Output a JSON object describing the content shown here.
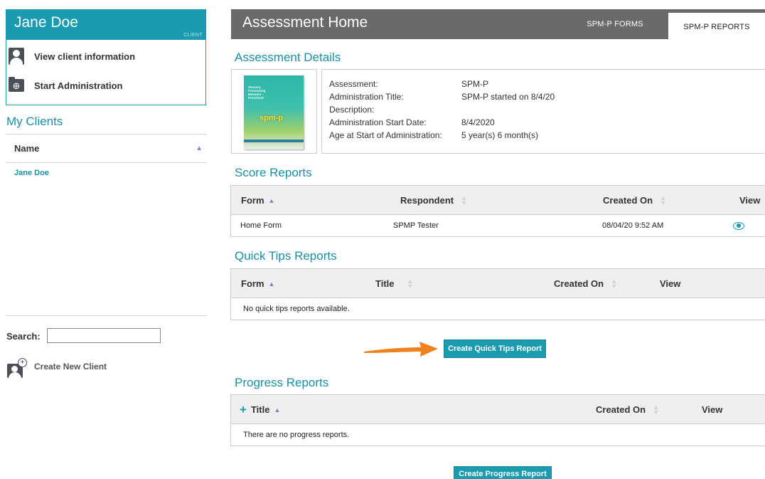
{
  "client": {
    "name": "Jane Doe",
    "tag": "CLIENT",
    "view_info_label": "View client information",
    "start_admin_label": "Start Administration"
  },
  "my_clients": {
    "title": "My Clients",
    "column": "Name",
    "items": [
      "Jane Doe"
    ]
  },
  "search": {
    "label": "Search:",
    "value": ""
  },
  "new_client_label": "Create New Client",
  "header": {
    "title": "Assessment Home",
    "tabs": [
      {
        "label": "SPM-P FORMS",
        "active": false
      },
      {
        "label": "SPM-P REPORTS",
        "active": true
      }
    ]
  },
  "assessment_details": {
    "title": "Assessment Details",
    "cover": {
      "lines": [
        "Sensory",
        "Processing",
        "Measure -",
        "Preschool"
      ],
      "logo": "spm-p"
    },
    "rows": [
      {
        "key": "Assessment:",
        "value": "SPM-P"
      },
      {
        "key": "Administration Title:",
        "value": "SPM-P started on 8/4/20"
      },
      {
        "key": "Description:",
        "value": ""
      },
      {
        "key": "Administration Start Date:",
        "value": "8/4/2020"
      },
      {
        "key": "Age at Start of Administration:",
        "value": "5 year(s) 6 month(s)"
      }
    ]
  },
  "score_reports": {
    "title": "Score Reports",
    "columns": [
      "Form",
      "Respondent",
      "Created On",
      "View"
    ],
    "rows": [
      {
        "form": "Home Form",
        "respondent": "SPMP Tester",
        "created_on": "08/04/20 9:52 AM"
      }
    ]
  },
  "quick_tips": {
    "title": "Quick Tips Reports",
    "columns": [
      "Form",
      "Title",
      "Created On",
      "View"
    ],
    "empty_message": "No quick tips reports available.",
    "create_button": "Create Quick Tips Report"
  },
  "progress_reports": {
    "title": "Progress Reports",
    "columns": [
      "Title",
      "Created On",
      "View"
    ],
    "empty_message": "There are no progress reports.",
    "create_button": "Create Progress Report"
  },
  "colors": {
    "accent": "#1a9bb0",
    "header_gray": "#6a6a6a",
    "arrow": "#f0821e"
  }
}
